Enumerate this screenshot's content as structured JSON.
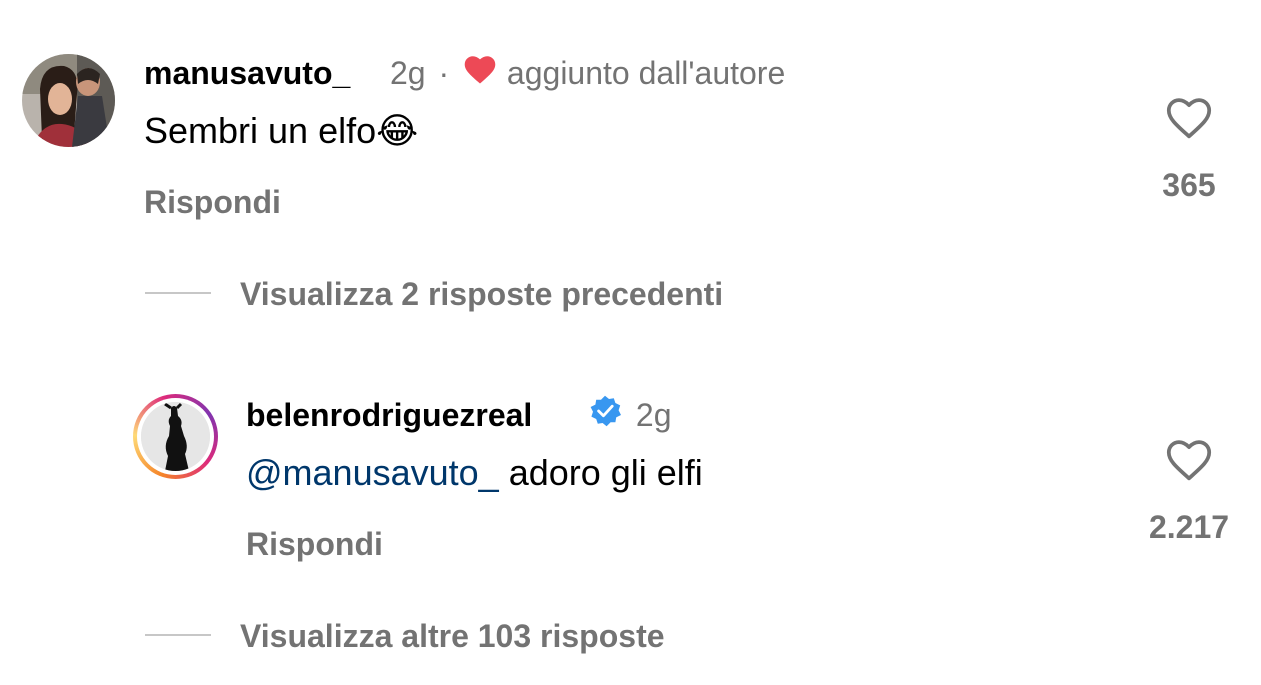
{
  "comments": [
    {
      "username": "manusavuto_",
      "time": "2g",
      "separator": "·",
      "liked_by_author_label": "aggiunto dall'autore",
      "text": "Sembri un elfo",
      "emoji": "😂",
      "reply_label": "Rispondi",
      "likes": "365",
      "view_replies_label": "Visualizza 2 risposte precedenti"
    },
    {
      "username": "belenrodriguezreal",
      "verified": true,
      "time": "2g",
      "mention": "@manusavuto_",
      "text": " adoro gli elfi",
      "reply_label": "Rispondi",
      "likes": "2.217",
      "view_replies_label": "Visualizza altre 103 risposte"
    }
  ],
  "colors": {
    "secondary_text": "#737373",
    "heart_red": "#ed4956",
    "verified_blue": "#3897f0",
    "mention_blue": "#00376b"
  }
}
